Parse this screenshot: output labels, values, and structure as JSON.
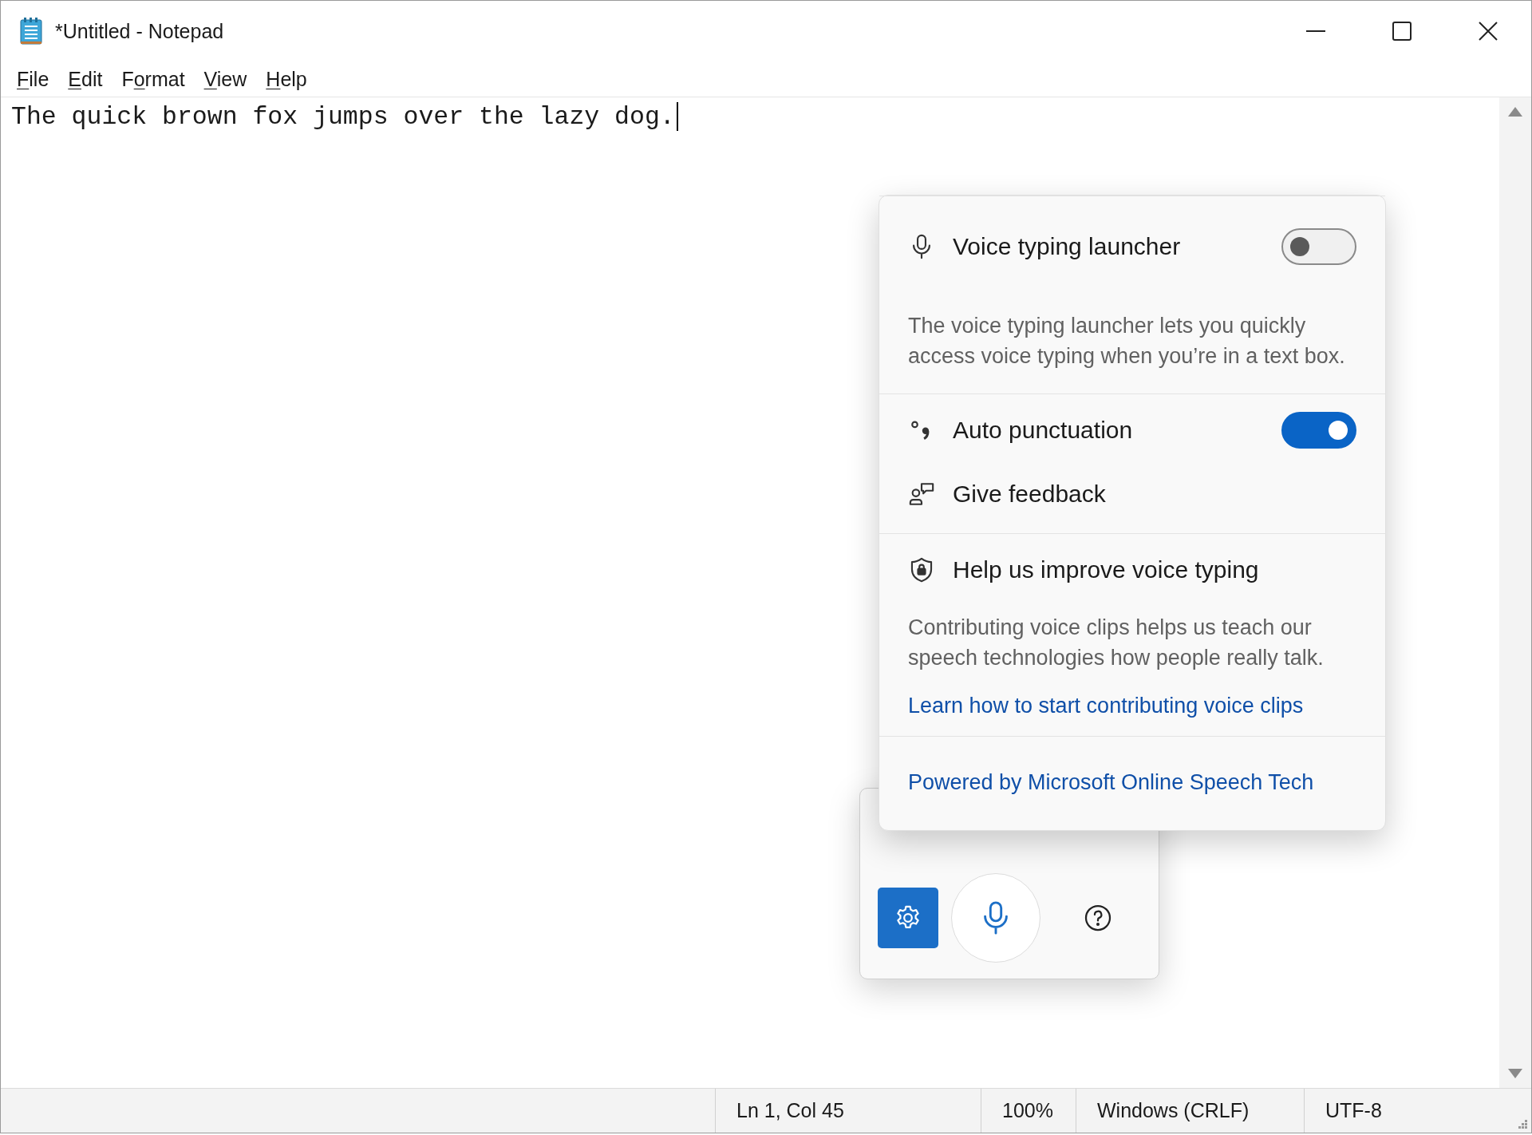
{
  "window": {
    "title": "*Untitled - Notepad"
  },
  "menu": [
    {
      "label": "File"
    },
    {
      "label": "Edit"
    },
    {
      "label": "Format"
    },
    {
      "label": "View"
    },
    {
      "label": "Help"
    }
  ],
  "editor": {
    "text": "The quick brown fox jumps over the lazy dog."
  },
  "voice_settings": {
    "groups": [
      [
        {
          "kind": "toggle",
          "title": "Voice typing launcher",
          "on": false,
          "description": "The voice typing launcher lets you quickly access voice typing when you’re in a text box."
        }
      ],
      [
        {
          "kind": "toggle",
          "title": "Auto punctuation",
          "on": true
        },
        {
          "kind": "action",
          "title": "Give feedback"
        }
      ],
      [
        {
          "kind": "info",
          "title": "Help us improve voice typing",
          "description": "Contributing voice clips helps us teach our speech technologies how people really talk.",
          "link": "Learn how to start contributing voice clips"
        }
      ],
      [
        {
          "kind": "footer",
          "link": "Powered by Microsoft Online Speech Tech"
        }
      ]
    ]
  },
  "launcher": {
    "buttons": [
      {
        "kind": "settings",
        "selected": true
      },
      {
        "kind": "microphone",
        "selected": false
      },
      {
        "kind": "help",
        "selected": false
      }
    ]
  },
  "status_bar": [
    "Ln 1, Col 45",
    "100%",
    "Windows (CRLF)",
    "UTF-8"
  ]
}
